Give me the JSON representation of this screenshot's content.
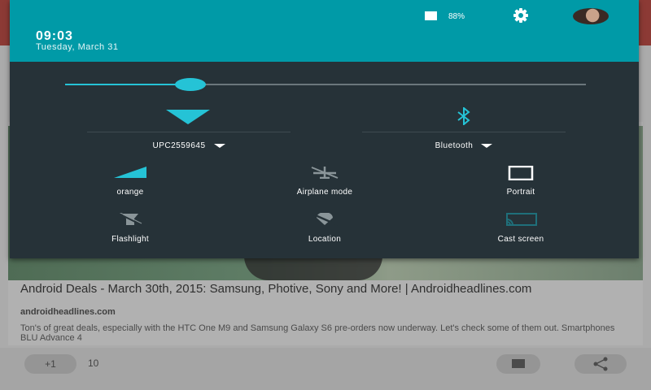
{
  "status_bar": {
    "time": "09:03",
    "date": "Tuesday, March 31",
    "battery": "88%",
    "battery_icon": "battery-icon",
    "settings_icon": "gear-icon",
    "accent_color": "#009aa7"
  },
  "brightness": {
    "level": 0.24,
    "color": "#25c3d6"
  },
  "big_tiles": {
    "wifi": {
      "label": "UPC2559645",
      "icon": "wifi-icon"
    },
    "bluetooth": {
      "label": "Bluetooth",
      "icon": "bluetooth-icon"
    }
  },
  "tiles": [
    {
      "label": "orange",
      "icon": "cellular-signal-icon"
    },
    {
      "label": "Airplane mode",
      "icon": "airplane-icon"
    },
    {
      "label": "Portrait",
      "icon": "rotation-lock-icon"
    },
    {
      "label": "Flashlight",
      "icon": "flashlight-icon"
    },
    {
      "label": "Location",
      "icon": "location-off-icon"
    },
    {
      "label": "Cast screen",
      "icon": "cast-icon"
    }
  ],
  "article": {
    "title": "Android Deals - March 30th, 2015: Samsung, Photive, Sony and More! | Androidheadlines.com",
    "source": "androidheadlines.com",
    "snippet": "Ton's of great deals, especially with the HTC One M9 and Samsung Galaxy S6 pre-orders now underway. Let's check some of them out. Smartphones BLU Advance 4",
    "plus_one": "+1",
    "count": "10"
  }
}
